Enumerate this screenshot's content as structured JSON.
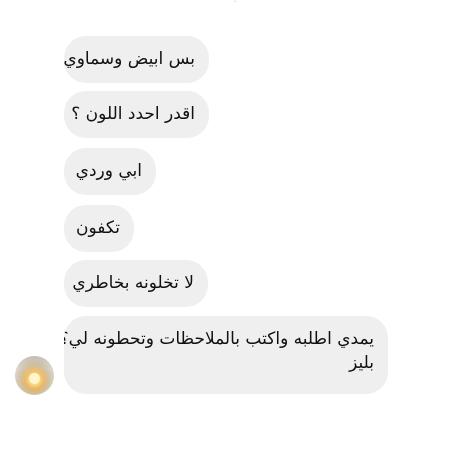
{
  "messages": [
    {
      "text": "بس ابيض وسماوي؟"
    },
    {
      "text": "اقدر احدد اللون ؟"
    },
    {
      "text": "ابي وردي"
    },
    {
      "text": "تكفون"
    },
    {
      "text": "لا تخلونه بخاطري"
    },
    {
      "lines": [
        "يمدي اطلبه واكتب بالملاحظات وتحطونه لي؟",
        "بليز"
      ]
    }
  ],
  "top_fragment": ".",
  "avatar": {
    "icon": "sunset-profile-photo"
  }
}
